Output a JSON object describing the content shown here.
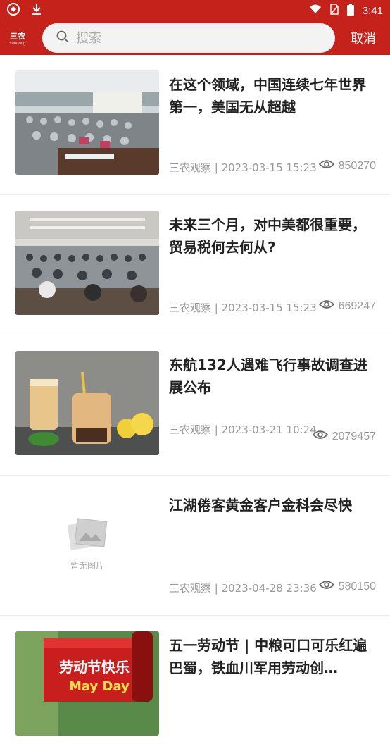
{
  "status_bar": {
    "time": "3:41"
  },
  "header": {
    "logo_line1": "三农",
    "logo_line2": "sannong",
    "search_placeholder": "搜索",
    "cancel_label": "取消"
  },
  "articles": [
    {
      "title": "在这个领域，中国连续七年世界第一，美国无从超越",
      "meta": "三农观察 | 2023-03-15 15:23",
      "views": "850270",
      "image": "meeting-hall-photo"
    },
    {
      "title": "未来三个月，对中美都很重要， 贸易税何去何从?",
      "meta": "三农观察 | 2023-03-15 15:23",
      "views": "669247",
      "image": "conference-photo"
    },
    {
      "title": "东航132人遇难飞行事故调查进展公布",
      "meta": "三农观察 | 2023-03-21 10:24",
      "views": "2079457",
      "image": "milk-tea-photo"
    },
    {
      "title": "江湖倦客黄金客户金科会尽快",
      "meta": "三农观察 | 2023-04-28 23:36",
      "views": "580150",
      "image": "no-image-placeholder",
      "no_image_text": "暂无图片"
    },
    {
      "title": "五一劳动节 | 中粮可口可乐红遍巴蜀，铁血川军用劳动创…",
      "meta": "",
      "views": "",
      "image": "labor-day-photo",
      "image_text_1": "劳动节快乐",
      "image_text_2": "May Day"
    }
  ],
  "colors": {
    "brand_red": "#c4221a",
    "meta_gray": "#9a9a9a"
  }
}
